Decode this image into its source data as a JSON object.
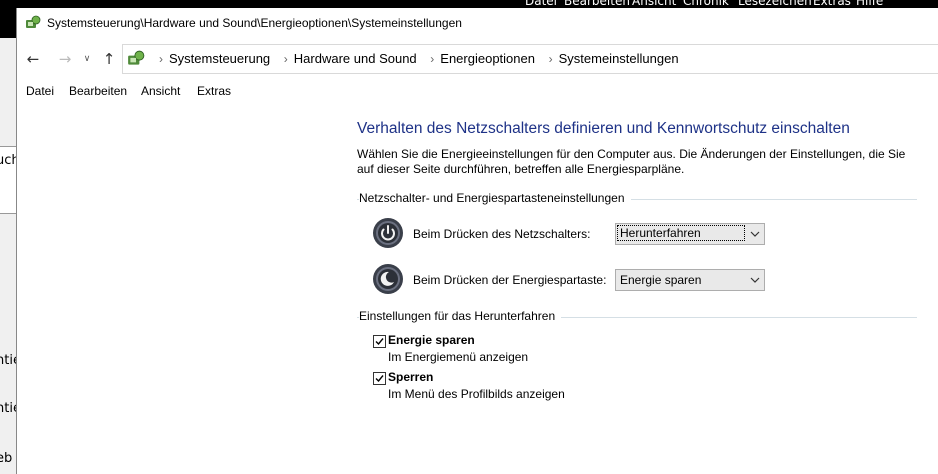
{
  "background": {
    "menu": [
      "Datei",
      "Bearbeiten",
      "Ansicht",
      "Chronik",
      "Lesezeichen",
      "Extras",
      "Hilfe"
    ],
    "fragments": [
      "uch",
      "ntie",
      "ntie",
      "eb"
    ]
  },
  "window": {
    "title": "Systemsteuerung\\Hardware und Sound\\Energieoptionen\\Systemeinstellungen",
    "breadcrumbs": [
      "Systemsteuerung",
      "Hardware und Sound",
      "Energieoptionen",
      "Systemeinstellungen"
    ],
    "menu": [
      "Datei",
      "Bearbeiten",
      "Ansicht",
      "Extras"
    ]
  },
  "content": {
    "heading": "Verhalten des Netzschalters definieren und Kennwortschutz einschalten",
    "description": "Wählen Sie die Energieeinstellungen für den Computer aus. Die Änderungen der Einstellungen, die Sie auf dieser Seite durchführen, betreffen alle Energiesparpläne.",
    "power_section": {
      "title": "Netzschalter- und Energiespartasteneinstellungen",
      "power_button_label": "Beim Drücken des Netzschalters:",
      "power_button_value": "Herunterfahren",
      "sleep_button_label": "Beim Drücken der Energiespartaste:",
      "sleep_button_value": "Energie sparen"
    },
    "shutdown_section": {
      "title": "Einstellungen für das Herunterfahren",
      "items": [
        {
          "title": "Energie sparen",
          "subtitle": "Im Energiemenü anzeigen",
          "checked": true
        },
        {
          "title": "Sperren",
          "subtitle": "Im Menü des Profilbilds anzeigen",
          "checked": true
        }
      ]
    }
  },
  "colors": {
    "heading": "#1e3287",
    "section_line": "#d5dfe5"
  }
}
